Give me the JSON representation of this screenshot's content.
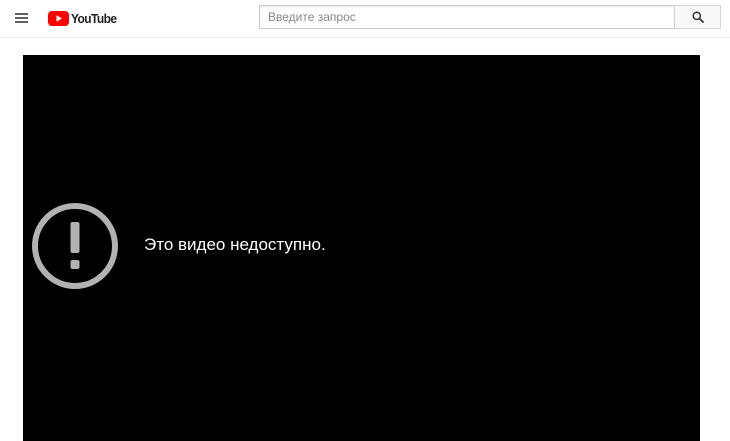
{
  "header": {
    "menu_icon": "hamburger-menu-icon",
    "logo_text": "YouTube",
    "logo_color": "#ff0000",
    "search": {
      "placeholder": "Введите запрос",
      "value": ""
    },
    "search_icon": "search-icon"
  },
  "player": {
    "background": "#000000",
    "error_icon": "exclamation-circle-icon",
    "error_message": "Это видео недоступно."
  }
}
